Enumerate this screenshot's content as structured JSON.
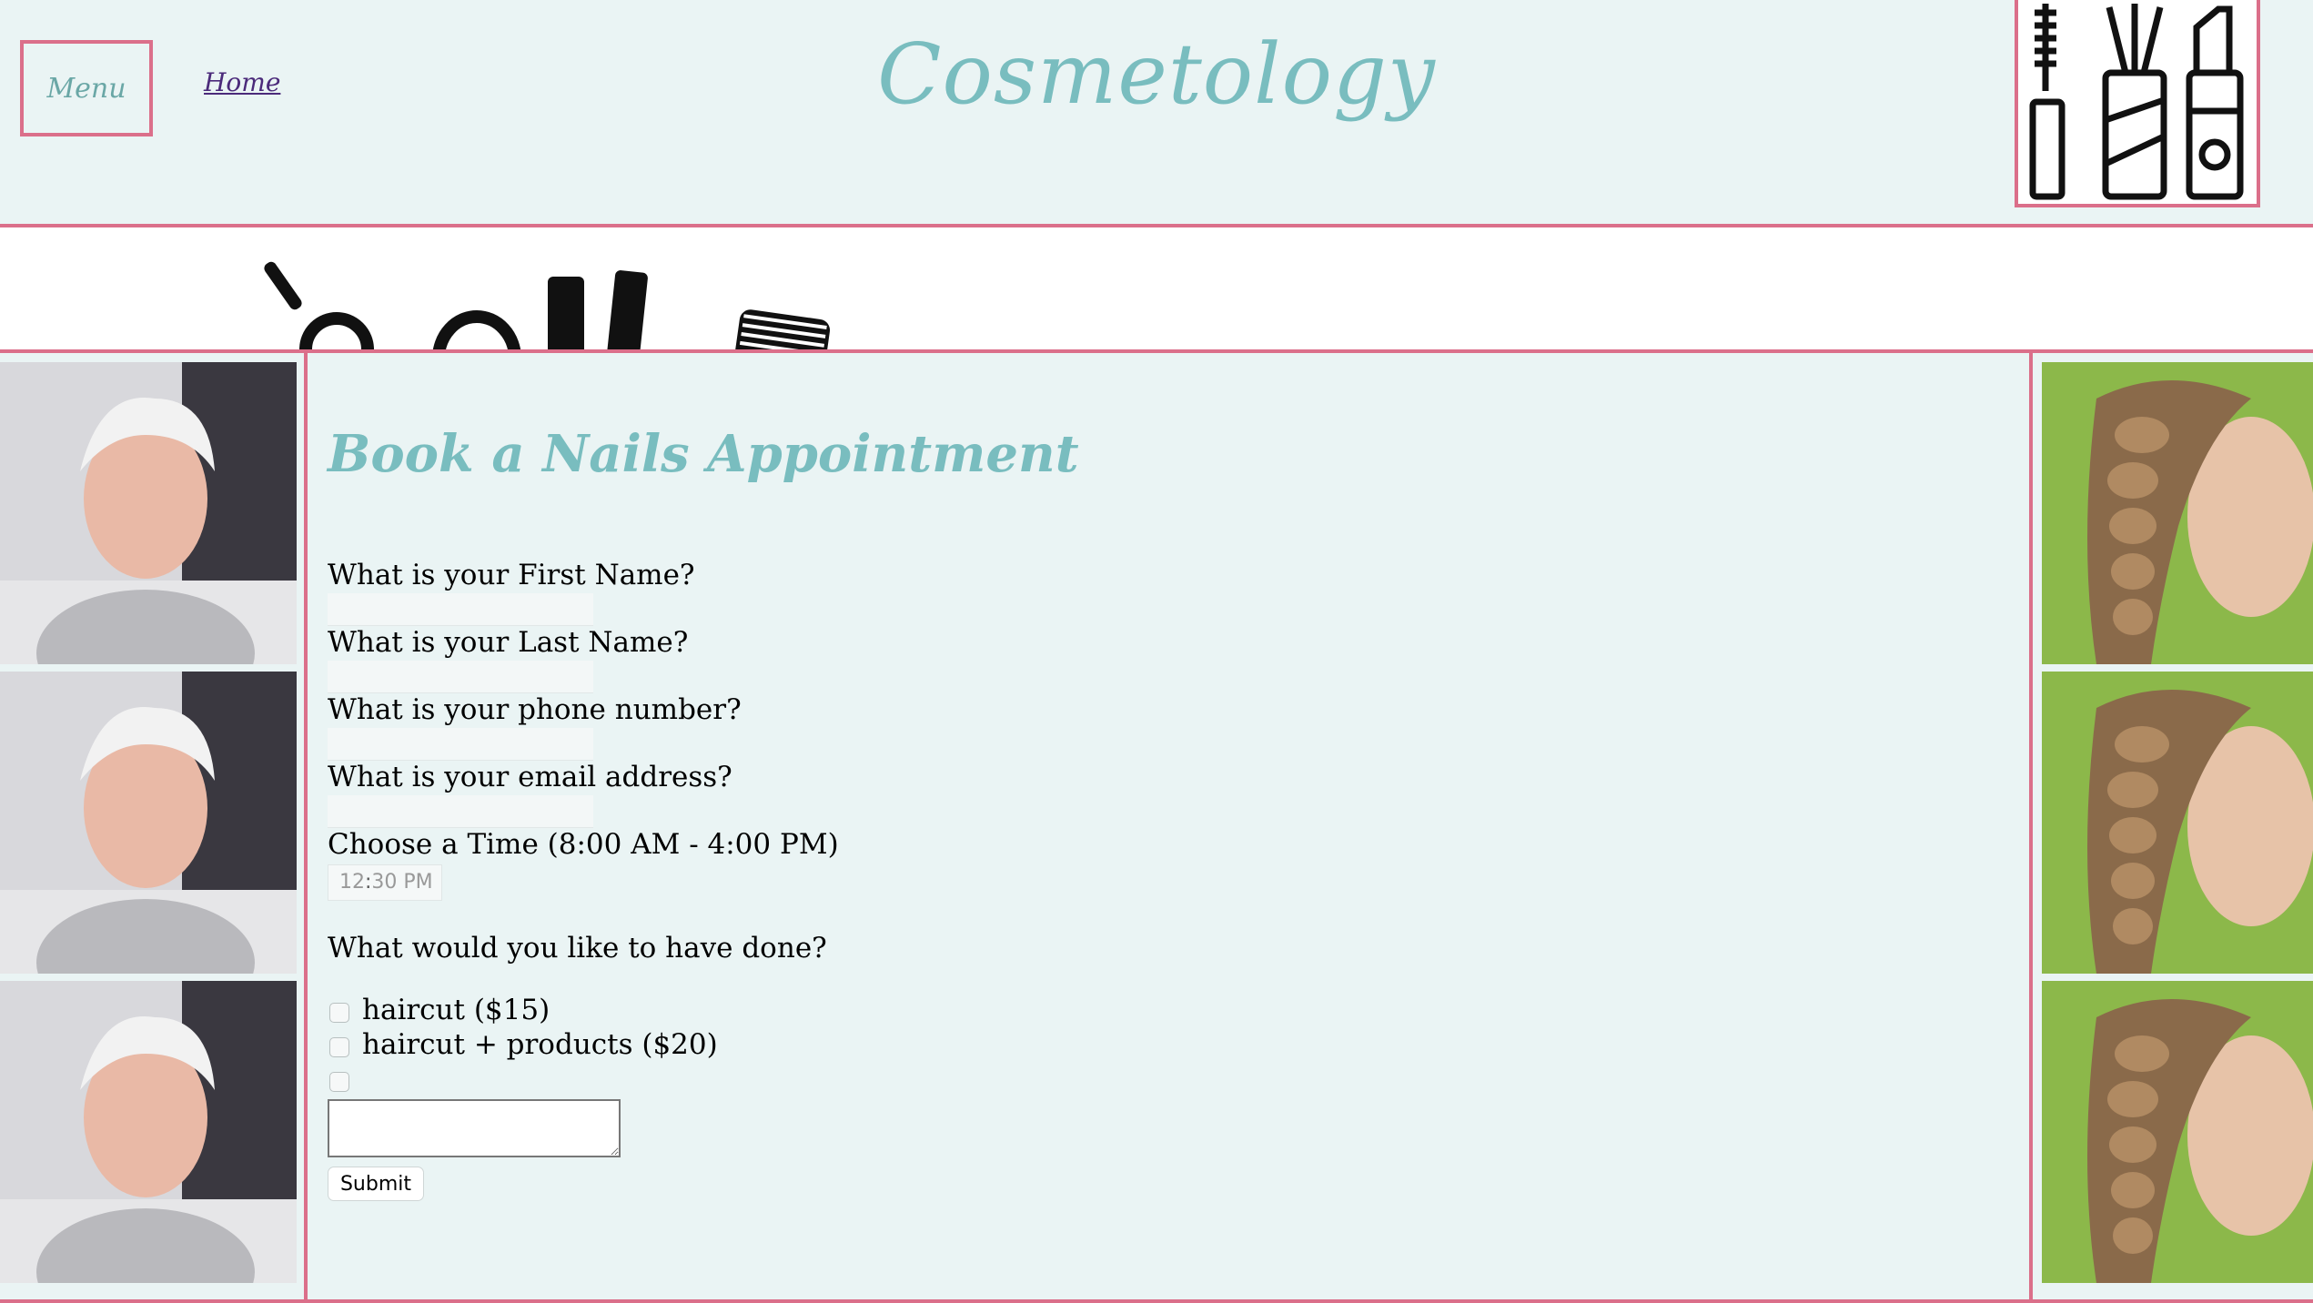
{
  "header": {
    "menu_label": "Menu",
    "home_label": "Home",
    "site_title": "Cosmetology"
  },
  "form": {
    "title": "Book a Nails Appointment",
    "first_name_label": "What is your First Name?",
    "last_name_label": "What is your Last Name?",
    "phone_label": "What is your phone number?",
    "email_label": "What is your email address?",
    "time_label": "Choose a Time (8:00 AM - 4:00 PM)",
    "time_hour": "12",
    "time_rest": "30 PM",
    "services_label": "What would you like to have done?",
    "options": [
      {
        "label": "haircut ($15)"
      },
      {
        "label": "haircut + products ($20)"
      },
      {
        "label": ""
      }
    ],
    "submit_label": "Submit"
  },
  "colors": {
    "accent_teal": "#79bdbf",
    "border_pink": "#db6f8a",
    "background": "#eaf4f4"
  }
}
